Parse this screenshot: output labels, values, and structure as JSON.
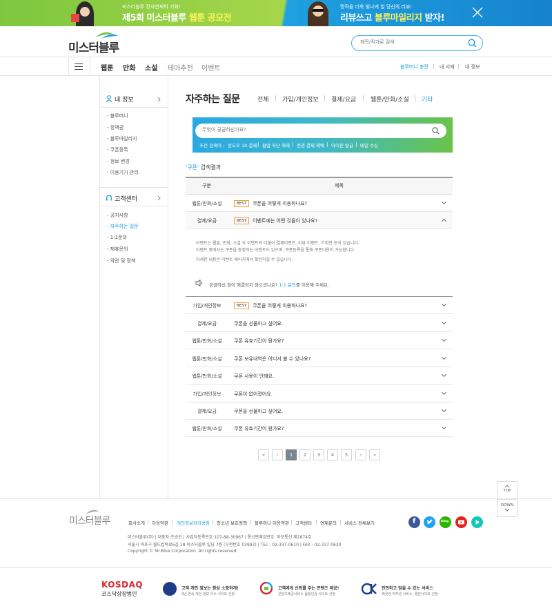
{
  "banner": {
    "left_small": "미스터블루 장사연재의 기회!",
    "left_big_prefix": "제5회 미스터블루 ",
    "left_big_highlight": "웹툰 공모전",
    "right_small": "명작을 더욱 빛나게 할 당신의 리뷰!",
    "right_big_prefix": "리뷰쓰고 ",
    "right_big_highlight": "블루마일리지",
    "right_big_suffix": " 받자!"
  },
  "header": {
    "logo": "미스터블루",
    "search_placeholder": "제목/작가로 검색"
  },
  "gnb": {
    "items": [
      "웹툰",
      "만화",
      "소설",
      "테마추천",
      "이벤트"
    ],
    "right": [
      "블루머니 충전",
      "내 서재",
      "내 정보"
    ]
  },
  "sidebar": {
    "myinfo_title": "내 정보",
    "myinfo_items": [
      "- 블루머니",
      "- 정액권",
      "- 블루마일리지",
      "- 쿠폰등록",
      "- 정보 변경",
      "- 이용기기 관리"
    ],
    "cs_title": "고객센터",
    "cs_items": [
      "- 공지사항",
      "- 자주하는 질문",
      "- 1:1문의",
      "- 제휴문의",
      "- 약관 및 정책"
    ]
  },
  "main": {
    "title": "자주하는 질문",
    "tabs": [
      "전체",
      "가입/개인정보",
      "결제/요금",
      "웹툰/만화/소설",
      "기타"
    ],
    "search_placeholder": "무엇이 궁금하신가요?",
    "recommend_label": "추천 검색어 :",
    "recommend": [
      "윈도우 10 결제",
      "팝업 차단 해제",
      "전권 결제 혜택",
      "아이핀 발급",
      "메일 수신"
    ],
    "result_keyword": "'쿠폰'",
    "result_suffix": " 검색결과",
    "col_category": "구분",
    "col_title": "제목",
    "best_label": "BEST",
    "rows": [
      {
        "cat": "웹툰/만화/소설",
        "title": "쿠폰을 어떻게 이용하나요?",
        "best": true
      },
      {
        "cat": "결제/요금",
        "title": "이벤트에는 어떤 것들이 있나요?",
        "best": true
      },
      {
        "cat": "가입/개인정보",
        "title": "쿠폰을 어떻게 이용하나요?",
        "best": true
      },
      {
        "cat": "결제/요금",
        "title": "쿠폰을 선물하고 싶어요.",
        "best": false
      },
      {
        "cat": "웹툰/만화/소설",
        "title": "쿠폰 유효기간이 뭔가요?",
        "best": false
      },
      {
        "cat": "웹툰/만화/소설",
        "title": "쿠폰 보유내역은 어디서 볼 수 있나요?",
        "best": false
      },
      {
        "cat": "웹툰/만화/소설",
        "title": "쿠폰 사용이 안돼요.",
        "best": false
      },
      {
        "cat": "가입/개인정보",
        "title": "쿠폰이 없어졌어요.",
        "best": false
      },
      {
        "cat": "결제/요금",
        "title": "쿠폰을 선물하고 싶어요.",
        "best": false
      },
      {
        "cat": "웹툰/만화/소설",
        "title": "쿠폰 유효기간이 뭔가요?",
        "best": false
      }
    ],
    "answer_lines": [
      "이벤트는 웹툰, 만화, 소설 각 이벤트와 더불어 결제이벤트, 리뷰 이벤트, 기획전 등이 있습니다.",
      "이벤트 중에서는 쿠폰을 증정하는 이벤트도 있으며, 쿠폰등록을 통해 쿠폰이용이 가능합니다.",
      "자세한 내용은 이벤트 페이지에서 확인하실 수 있습니다."
    ],
    "answer_note_prefix": "궁금하신 점이 해결되지 않으셨나요? ",
    "answer_note_link": "1:1 문의",
    "answer_note_suffix": "를 이용해 주세요.",
    "pages": [
      "«",
      "‹",
      "1",
      "2",
      "3",
      "4",
      "5",
      "›",
      "»"
    ]
  },
  "floating": {
    "top": "TOP",
    "down": "DOWN"
  },
  "footer": {
    "logo": "미스터블루",
    "links": [
      "회사소개",
      "이용약관",
      "개인정보처리방침",
      "청소년 보호정책",
      "블루머니 이용약관",
      "고객센터",
      "연재문의",
      "서비스 전체보기"
    ],
    "info1": "미스터블루(주)  |  대표자:조승진  |  사업자등록번호:107-88-30967  |  통신판매업번호: 마포통신 제1874호",
    "info2": "서울시 마포구 월드컵북로6길 18 미스터블루 빌딩 7층 (우편번호 03992)  |  TEL : 02-337-0610  |  FAX : 02-337-0630",
    "copyright": "Copyright © Mr.Blue Corporation. All rights reserved.",
    "kosdaq_logo": "KOSDAQ",
    "kosdaq_sub": "코스닥상장법인",
    "cert1_title": "고객 개인 정보는 항상 소중하게!",
    "cert1_sub": "9년 연속 개인 정보 우수 사이트 선정",
    "cert2_title": "고객에게 신뢰를 주는 콘텐츠 제공!",
    "cert2_sub": "콘텐츠제공서비스 품질인증 사이트 선정",
    "cert3_title": "안전하고 믿을 수 있는 서비스",
    "cert3_sub": "깨끗한 저작권 서비스, 클린사이트 선정"
  },
  "colors": {
    "accent": "#1fa0e0",
    "green": "#6ac34a",
    "best_border": "#f0a030"
  }
}
